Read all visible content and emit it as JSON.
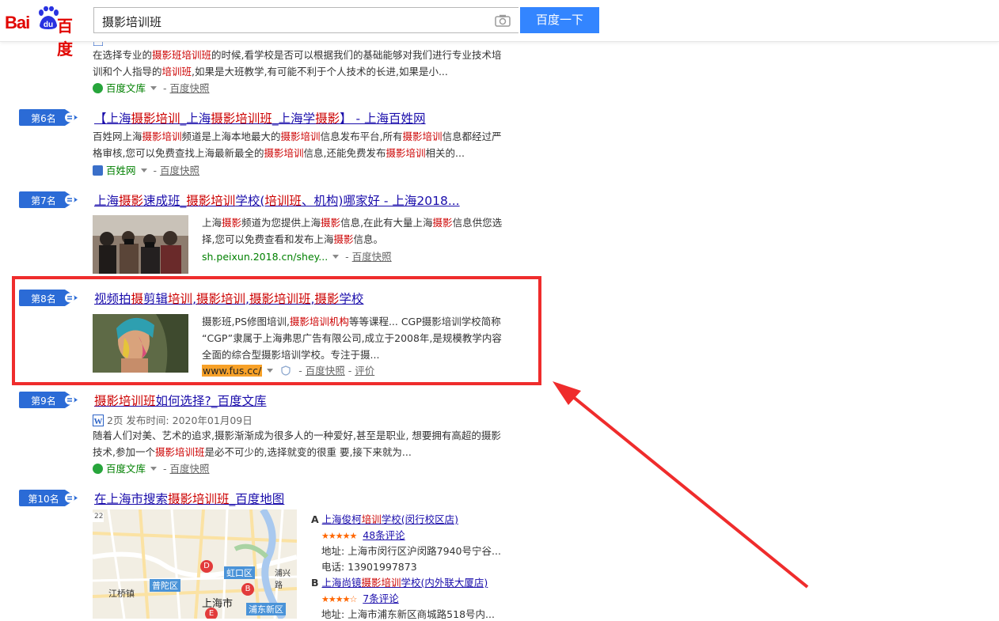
{
  "header": {
    "logo_latin": "Bai",
    "logo_du": "du",
    "logo_cn": "百度",
    "query": "摄影培训班",
    "search_button": "百度一下"
  },
  "results": [
    {
      "snippet_line1": [
        "在选择专业的",
        "摄影班培训班",
        "的时候,看学校是否可以根据我们的基础能够对我们进行专业技术培"
      ],
      "snippet_line2": [
        "训和个人指导的",
        "培训班",
        ",如果是大班教学,有可能不利于个人技术的长进,如果是小..."
      ],
      "source": "百度文库",
      "snapshot": "百度快照"
    },
    {
      "rank": "第6名",
      "title": [
        "【上海",
        "摄影培训",
        "_上海",
        "摄影培训班",
        "_上海学",
        "摄影",
        "】 - 上海百姓网"
      ],
      "snippet_line1": [
        "百姓网上海",
        "摄影培训",
        "频道是上海本地最大的",
        "摄影培训",
        "信息发布平台,所有",
        "摄影培训",
        "信息都经过严"
      ],
      "snippet_line2": [
        "格审核,您可以免费查找上海最新最全的",
        "摄影培训",
        "信息,还能免费发布",
        "摄影培训",
        "相关的..."
      ],
      "source": "百姓网",
      "snapshot": "百度快照"
    },
    {
      "rank": "第7名",
      "title": [
        "上海",
        "摄影",
        "速成班_",
        "摄影培训",
        "学校(",
        "培训班",
        "、机构)哪家好 - 上海2018..."
      ],
      "snippet_line1": [
        "上海",
        "摄影",
        "频道为您提供上海",
        "摄影",
        "信息,在此有大量上海",
        "摄影",
        "信息供您选"
      ],
      "snippet_line2": [
        "择,您可以免费查看和发布上海",
        "摄影",
        "信息。"
      ],
      "source": "sh.peixun.2018.cn/shey...",
      "snapshot": "百度快照"
    },
    {
      "rank": "第8名",
      "title": [
        "视频拍",
        "摄",
        "剪辑",
        "培训",
        ",",
        "摄影培训",
        ",",
        "摄影培训班",
        ",",
        "摄影",
        "学校"
      ],
      "snippet_line1": [
        "摄影班,PS修图培训,",
        "摄影培训机构",
        "等等课程... CGP摄影培训学校简称"
      ],
      "snippet_line2": [
        "“CGP”隶属于上海弗思广告有限公司,成立于2008年,是规模教学内容"
      ],
      "snippet_line3": [
        "全面的综合型摄影培训学校。专注于摄..."
      ],
      "source": "www.fus.cc/",
      "snapshot": "百度快照",
      "review": "评价"
    },
    {
      "rank": "第9名",
      "title": [
        "摄影培训班",
        "如何选择?_百度文库"
      ],
      "doc_meta": "2页 发布时间: 2020年01月09日",
      "snippet_line1": [
        "随着人们对美、艺术的追求,摄影渐渐成为很多人的一种爱好,甚至是职业, 想要拥有高超的摄影"
      ],
      "snippet_line2": [
        "技术,参加一个",
        "摄影培训班",
        "是必不可少的,选择就变的很重 要,接下来就为..."
      ],
      "source": "百度文库",
      "snapshot": "百度快照"
    },
    {
      "rank": "第10名",
      "title": [
        "在上海市搜索",
        "摄影培训班",
        "_百度地图"
      ]
    }
  ],
  "map": {
    "labels": [
      "22",
      "虹口区",
      "普陀区",
      "江桥镇",
      "上海市",
      "浦东新区",
      "浦兴路",
      "D",
      "B",
      "E"
    ],
    "pois": [
      {
        "letter": "A",
        "name": [
          "上海俊柯",
          "培训",
          "学校(闵行校区店)"
        ],
        "stars": "★★★★★",
        "reviews": "48条评论",
        "address": "地址: 上海市闵行区沪闵路7940号宁谷...",
        "phone": "电话: 13901997873"
      },
      {
        "letter": "B",
        "name": [
          "上海尚镜",
          "摄影培训",
          "学校(内外联大厦店)"
        ],
        "stars": "★★★★☆",
        "reviews": "7条评论",
        "address": "地址: 上海市浦东新区商城路518号内..."
      }
    ]
  },
  "colors": {
    "accent": "#3385ff",
    "highlight_box": "#ef2c2c",
    "link": "#1a0dab",
    "keyword": "#c00000",
    "source_green": "#008000"
  }
}
